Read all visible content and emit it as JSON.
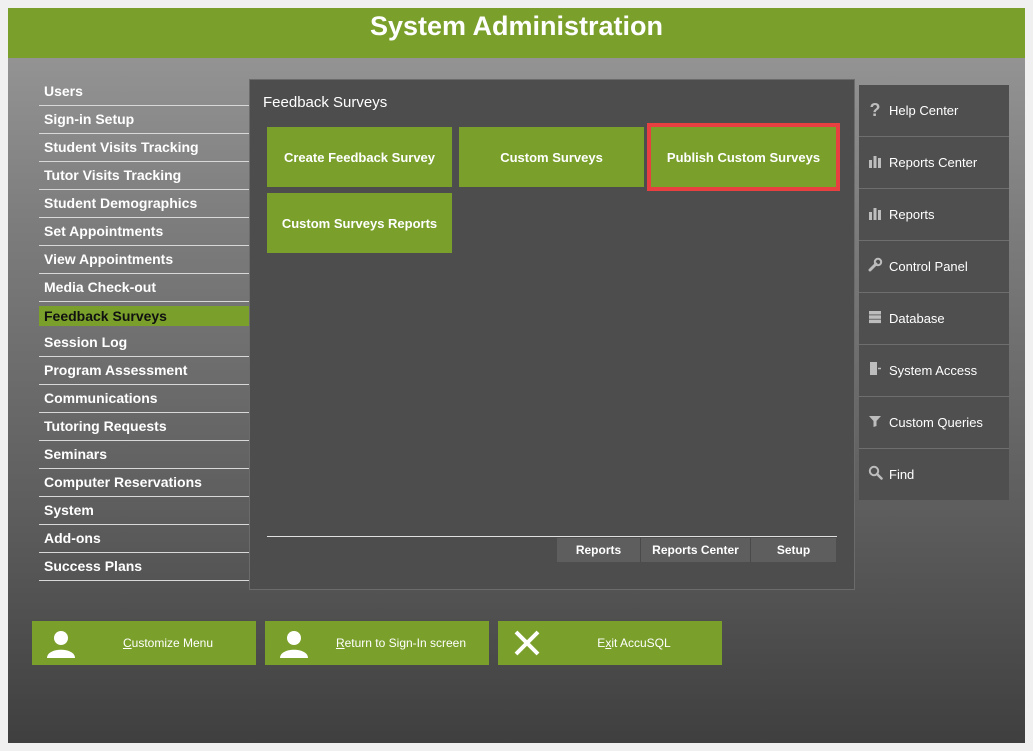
{
  "header": {
    "title": "System Administration"
  },
  "left_menu": [
    {
      "label": "Users"
    },
    {
      "label": "Sign-in Setup"
    },
    {
      "label": "Student Visits Tracking"
    },
    {
      "label": "Tutor Visits Tracking"
    },
    {
      "label": "Student Demographics"
    },
    {
      "label": "Set Appointments"
    },
    {
      "label": "View Appointments"
    },
    {
      "label": "Media Check-out"
    },
    {
      "label": "Feedback Surveys",
      "active": true
    },
    {
      "label": "Session Log"
    },
    {
      "label": "Program Assessment"
    },
    {
      "label": "Communications"
    },
    {
      "label": "Tutoring Requests"
    },
    {
      "label": "Seminars"
    },
    {
      "label": "Computer Reservations"
    },
    {
      "label": "System"
    },
    {
      "label": "Add-ons"
    },
    {
      "label": "Success Plans"
    }
  ],
  "panel": {
    "title": "Feedback Surveys",
    "tiles": [
      {
        "label": "Create Feedback Survey"
      },
      {
        "label": "Custom Surveys"
      },
      {
        "label": "Publish Custom Surveys",
        "selected": true
      },
      {
        "label": "Custom Surveys Reports"
      }
    ],
    "subbar": [
      {
        "label": "Reports"
      },
      {
        "label": "Reports Center"
      },
      {
        "label": "Setup"
      }
    ]
  },
  "right_nav": [
    {
      "label": "Help Center",
      "icon": "help-icon"
    },
    {
      "label": "Reports Center",
      "icon": "bar-chart-icon"
    },
    {
      "label": "Reports",
      "icon": "bar-chart-icon"
    },
    {
      "label": "Control Panel",
      "icon": "wrench-icon"
    },
    {
      "label": "Database",
      "icon": "database-icon"
    },
    {
      "label": "System Access",
      "icon": "door-icon"
    },
    {
      "label": "Custom Queries",
      "icon": "filter-icon"
    },
    {
      "label": "Find",
      "icon": "search-icon"
    }
  ],
  "bottom_buttons": [
    {
      "key": "C",
      "rest": "ustomize Menu",
      "icon": "user-icon"
    },
    {
      "key": "R",
      "rest": "eturn to Sign-In screen",
      "icon": "user-icon"
    },
    {
      "pre": "E",
      "key": "x",
      "rest": "it AccuSQL",
      "icon": "close-icon"
    }
  ],
  "colors": {
    "accent": "#7aa02b",
    "selection": "#e84040"
  }
}
